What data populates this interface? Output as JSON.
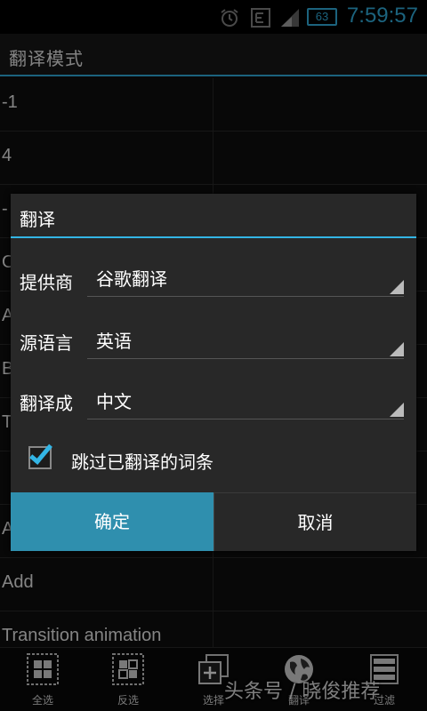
{
  "status_bar": {
    "battery": "63",
    "time": "7:59:57",
    "icons": [
      "alarm-icon",
      "data-icon",
      "signal-icon",
      "battery-icon"
    ]
  },
  "title_bar": {
    "title": "翻译模式"
  },
  "list": {
    "rows": [
      "-1",
      "4",
      "-",
      "O",
      "A",
      "B",
      "T",
      "",
      "A",
      "Add",
      "Transition animation"
    ]
  },
  "dialog": {
    "title": "翻译",
    "provider_label": "提供商",
    "provider_value": "谷歌翻译",
    "source_label": "源语言",
    "source_value": "英语",
    "target_label": "翻译成",
    "target_value": "中文",
    "skip_label": "跳过已翻译的词条",
    "skip_checked": true,
    "ok_label": "确定",
    "cancel_label": "取消"
  },
  "toolbar": {
    "items": [
      {
        "label": "全选",
        "icon": "select-all-icon"
      },
      {
        "label": "反选",
        "icon": "invert-selection-icon"
      },
      {
        "label": "选择",
        "icon": "add-selection-icon"
      },
      {
        "label": "翻译",
        "icon": "globe-icon"
      },
      {
        "label": "过滤",
        "icon": "filter-icon"
      }
    ]
  },
  "watermark": "头条号 / 晓俊推荐",
  "colors": {
    "accent": "#33b5e5",
    "ok_button": "#2f8fae"
  }
}
